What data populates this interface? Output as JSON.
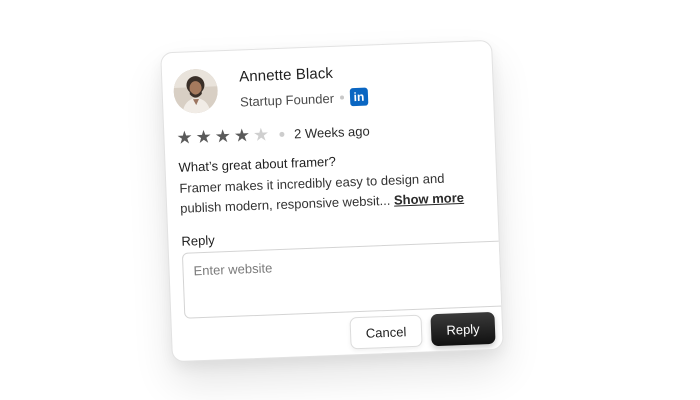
{
  "review": {
    "author_name": "Annette Black",
    "author_role": "Startup Founder",
    "social_icon": "linkedin-icon",
    "social_label": "in",
    "rating": 4,
    "rating_max": 5,
    "time_ago": "2 Weeks ago",
    "question": "What’s great about framer?",
    "body": "Framer makes it incredibly easy to design and publish modern, responsive websit...",
    "show_more_label": "Show more"
  },
  "reply": {
    "label": "Reply",
    "placeholder": "Enter website",
    "value": ""
  },
  "actions": {
    "cancel_label": "Cancel",
    "reply_label": "Reply"
  },
  "colors": {
    "linkedin": "#0a66c2",
    "star_filled": "#5a5a5a",
    "star_empty": "#cfcfcf",
    "primary_button": "#1a1a1a"
  }
}
